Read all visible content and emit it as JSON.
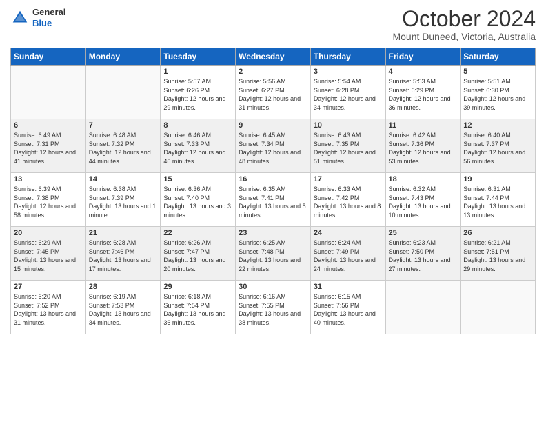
{
  "logo": {
    "general": "General",
    "blue": "Blue"
  },
  "header": {
    "month": "October 2024",
    "location": "Mount Duneed, Victoria, Australia"
  },
  "weekdays": [
    "Sunday",
    "Monday",
    "Tuesday",
    "Wednesday",
    "Thursday",
    "Friday",
    "Saturday"
  ],
  "weeks": [
    [
      {
        "day": "",
        "sunrise": "",
        "sunset": "",
        "daylight": ""
      },
      {
        "day": "",
        "sunrise": "",
        "sunset": "",
        "daylight": ""
      },
      {
        "day": "1",
        "sunrise": "Sunrise: 5:57 AM",
        "sunset": "Sunset: 6:26 PM",
        "daylight": "Daylight: 12 hours and 29 minutes."
      },
      {
        "day": "2",
        "sunrise": "Sunrise: 5:56 AM",
        "sunset": "Sunset: 6:27 PM",
        "daylight": "Daylight: 12 hours and 31 minutes."
      },
      {
        "day": "3",
        "sunrise": "Sunrise: 5:54 AM",
        "sunset": "Sunset: 6:28 PM",
        "daylight": "Daylight: 12 hours and 34 minutes."
      },
      {
        "day": "4",
        "sunrise": "Sunrise: 5:53 AM",
        "sunset": "Sunset: 6:29 PM",
        "daylight": "Daylight: 12 hours and 36 minutes."
      },
      {
        "day": "5",
        "sunrise": "Sunrise: 5:51 AM",
        "sunset": "Sunset: 6:30 PM",
        "daylight": "Daylight: 12 hours and 39 minutes."
      }
    ],
    [
      {
        "day": "6",
        "sunrise": "Sunrise: 6:49 AM",
        "sunset": "Sunset: 7:31 PM",
        "daylight": "Daylight: 12 hours and 41 minutes."
      },
      {
        "day": "7",
        "sunrise": "Sunrise: 6:48 AM",
        "sunset": "Sunset: 7:32 PM",
        "daylight": "Daylight: 12 hours and 44 minutes."
      },
      {
        "day": "8",
        "sunrise": "Sunrise: 6:46 AM",
        "sunset": "Sunset: 7:33 PM",
        "daylight": "Daylight: 12 hours and 46 minutes."
      },
      {
        "day": "9",
        "sunrise": "Sunrise: 6:45 AM",
        "sunset": "Sunset: 7:34 PM",
        "daylight": "Daylight: 12 hours and 48 minutes."
      },
      {
        "day": "10",
        "sunrise": "Sunrise: 6:43 AM",
        "sunset": "Sunset: 7:35 PM",
        "daylight": "Daylight: 12 hours and 51 minutes."
      },
      {
        "day": "11",
        "sunrise": "Sunrise: 6:42 AM",
        "sunset": "Sunset: 7:36 PM",
        "daylight": "Daylight: 12 hours and 53 minutes."
      },
      {
        "day": "12",
        "sunrise": "Sunrise: 6:40 AM",
        "sunset": "Sunset: 7:37 PM",
        "daylight": "Daylight: 12 hours and 56 minutes."
      }
    ],
    [
      {
        "day": "13",
        "sunrise": "Sunrise: 6:39 AM",
        "sunset": "Sunset: 7:38 PM",
        "daylight": "Daylight: 12 hours and 58 minutes."
      },
      {
        "day": "14",
        "sunrise": "Sunrise: 6:38 AM",
        "sunset": "Sunset: 7:39 PM",
        "daylight": "Daylight: 13 hours and 1 minute."
      },
      {
        "day": "15",
        "sunrise": "Sunrise: 6:36 AM",
        "sunset": "Sunset: 7:40 PM",
        "daylight": "Daylight: 13 hours and 3 minutes."
      },
      {
        "day": "16",
        "sunrise": "Sunrise: 6:35 AM",
        "sunset": "Sunset: 7:41 PM",
        "daylight": "Daylight: 13 hours and 5 minutes."
      },
      {
        "day": "17",
        "sunrise": "Sunrise: 6:33 AM",
        "sunset": "Sunset: 7:42 PM",
        "daylight": "Daylight: 13 hours and 8 minutes."
      },
      {
        "day": "18",
        "sunrise": "Sunrise: 6:32 AM",
        "sunset": "Sunset: 7:43 PM",
        "daylight": "Daylight: 13 hours and 10 minutes."
      },
      {
        "day": "19",
        "sunrise": "Sunrise: 6:31 AM",
        "sunset": "Sunset: 7:44 PM",
        "daylight": "Daylight: 13 hours and 13 minutes."
      }
    ],
    [
      {
        "day": "20",
        "sunrise": "Sunrise: 6:29 AM",
        "sunset": "Sunset: 7:45 PM",
        "daylight": "Daylight: 13 hours and 15 minutes."
      },
      {
        "day": "21",
        "sunrise": "Sunrise: 6:28 AM",
        "sunset": "Sunset: 7:46 PM",
        "daylight": "Daylight: 13 hours and 17 minutes."
      },
      {
        "day": "22",
        "sunrise": "Sunrise: 6:26 AM",
        "sunset": "Sunset: 7:47 PM",
        "daylight": "Daylight: 13 hours and 20 minutes."
      },
      {
        "day": "23",
        "sunrise": "Sunrise: 6:25 AM",
        "sunset": "Sunset: 7:48 PM",
        "daylight": "Daylight: 13 hours and 22 minutes."
      },
      {
        "day": "24",
        "sunrise": "Sunrise: 6:24 AM",
        "sunset": "Sunset: 7:49 PM",
        "daylight": "Daylight: 13 hours and 24 minutes."
      },
      {
        "day": "25",
        "sunrise": "Sunrise: 6:23 AM",
        "sunset": "Sunset: 7:50 PM",
        "daylight": "Daylight: 13 hours and 27 minutes."
      },
      {
        "day": "26",
        "sunrise": "Sunrise: 6:21 AM",
        "sunset": "Sunset: 7:51 PM",
        "daylight": "Daylight: 13 hours and 29 minutes."
      }
    ],
    [
      {
        "day": "27",
        "sunrise": "Sunrise: 6:20 AM",
        "sunset": "Sunset: 7:52 PM",
        "daylight": "Daylight: 13 hours and 31 minutes."
      },
      {
        "day": "28",
        "sunrise": "Sunrise: 6:19 AM",
        "sunset": "Sunset: 7:53 PM",
        "daylight": "Daylight: 13 hours and 34 minutes."
      },
      {
        "day": "29",
        "sunrise": "Sunrise: 6:18 AM",
        "sunset": "Sunset: 7:54 PM",
        "daylight": "Daylight: 13 hours and 36 minutes."
      },
      {
        "day": "30",
        "sunrise": "Sunrise: 6:16 AM",
        "sunset": "Sunset: 7:55 PM",
        "daylight": "Daylight: 13 hours and 38 minutes."
      },
      {
        "day": "31",
        "sunrise": "Sunrise: 6:15 AM",
        "sunset": "Sunset: 7:56 PM",
        "daylight": "Daylight: 13 hours and 40 minutes."
      },
      {
        "day": "",
        "sunrise": "",
        "sunset": "",
        "daylight": ""
      },
      {
        "day": "",
        "sunrise": "",
        "sunset": "",
        "daylight": ""
      }
    ]
  ]
}
